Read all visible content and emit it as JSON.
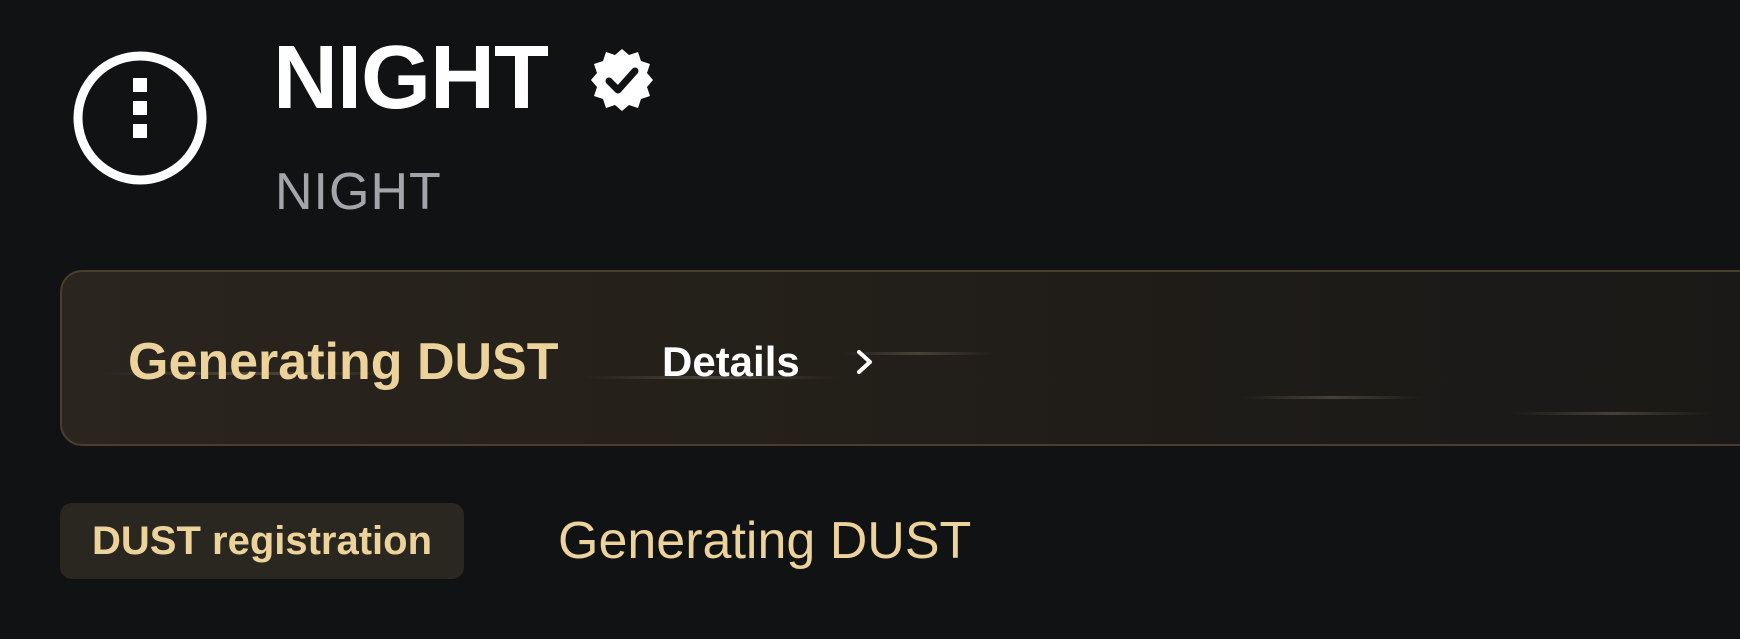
{
  "token": {
    "name": "NIGHT",
    "symbol": "NIGHT",
    "logo_icon": "night-token-logo-icon",
    "verified_icon": "verified-badge-icon"
  },
  "banner": {
    "status": "Generating DUST",
    "details_label": "Details",
    "details_icon": "chevron-right-icon"
  },
  "registration": {
    "badge_label": "DUST registration",
    "status": "Generating DUST"
  },
  "colors": {
    "background": "#111214",
    "accent_gold": "#ecd29b",
    "banner_border": "#4b3f2c",
    "secondary_text": "#a3a5ab"
  }
}
